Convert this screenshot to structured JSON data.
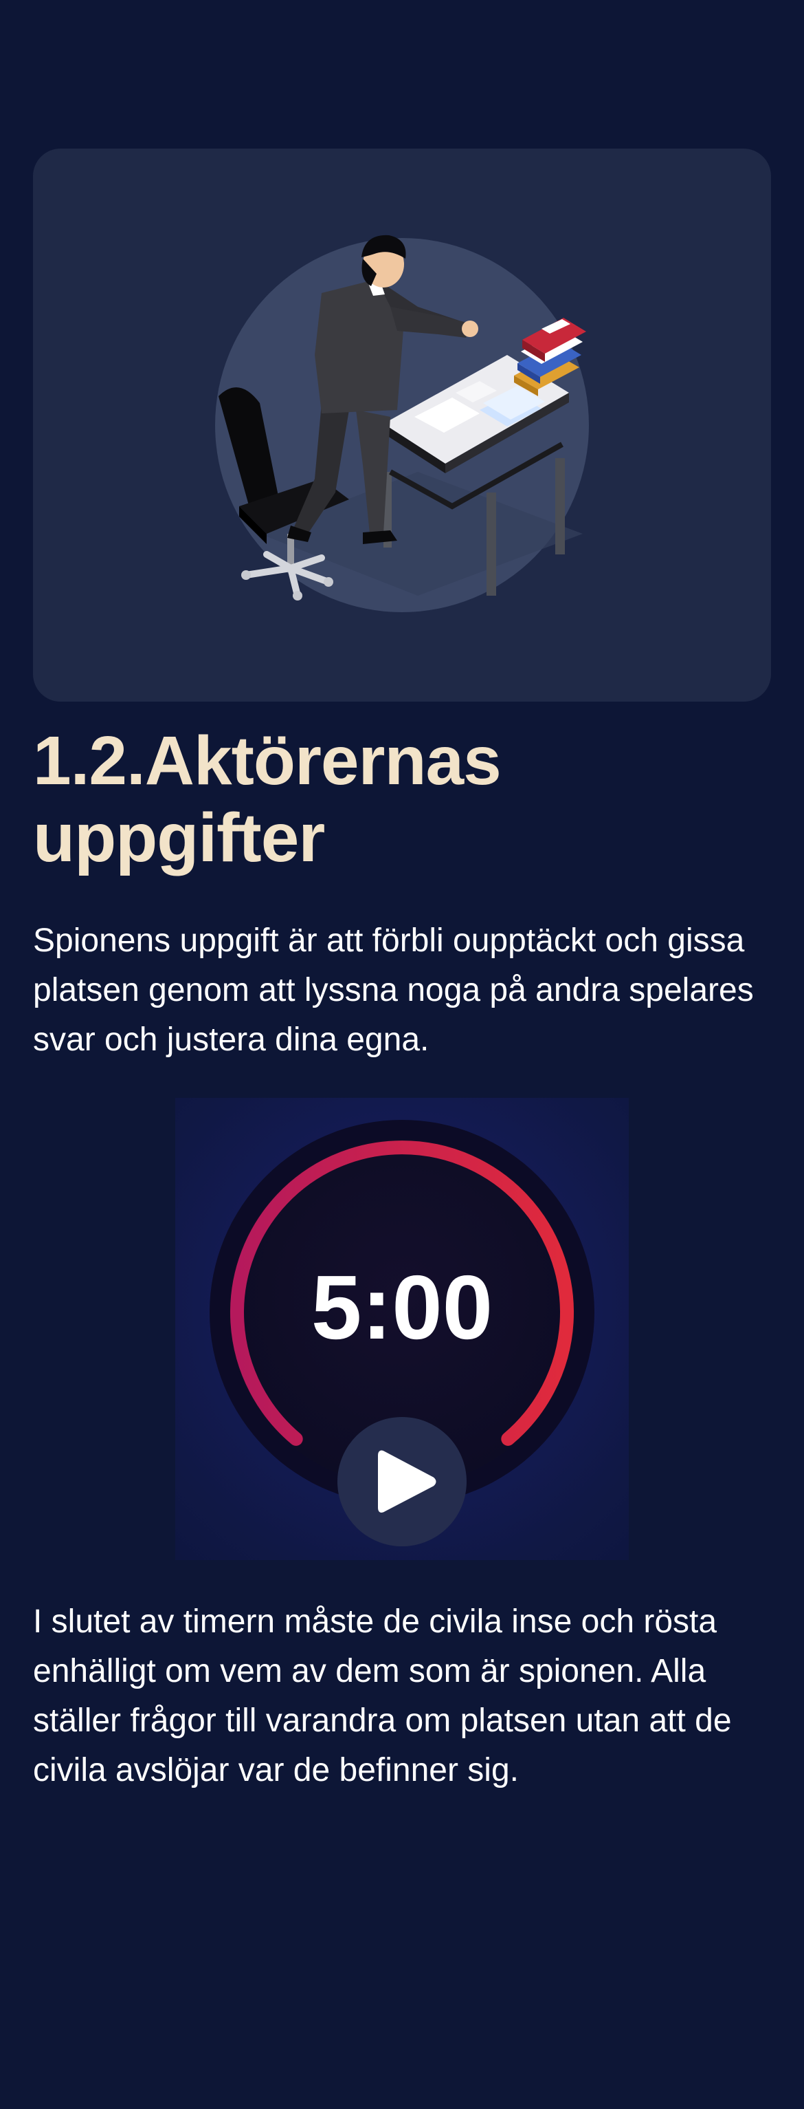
{
  "lesson": {
    "title": "1.2.Aktörernas uppgifter",
    "intro": "Spionens uppgift är att förbli oupptäckt och gissa platsen genom att lyssna noga på andra spelares svar och justera dina egna.",
    "outro": "I slutet av timern måste de civila inse och rösta enhälligt om vem av dem som är spionen. Alla ställer frågor till varandra om platsen utan att de civila avslöjar var de befinner sig."
  },
  "hero": {
    "illustration": "man-at-desk-writing-illustration"
  },
  "timer": {
    "time": "5:00",
    "progress": 1.0,
    "play_icon": "play-icon",
    "ring_color_start": "#b5195c",
    "ring_color_end": "#e02a3c"
  },
  "colors": {
    "background": "#0d1636",
    "card": "#1f2947",
    "title": "#f2e3c9",
    "text": "#ffffff"
  }
}
